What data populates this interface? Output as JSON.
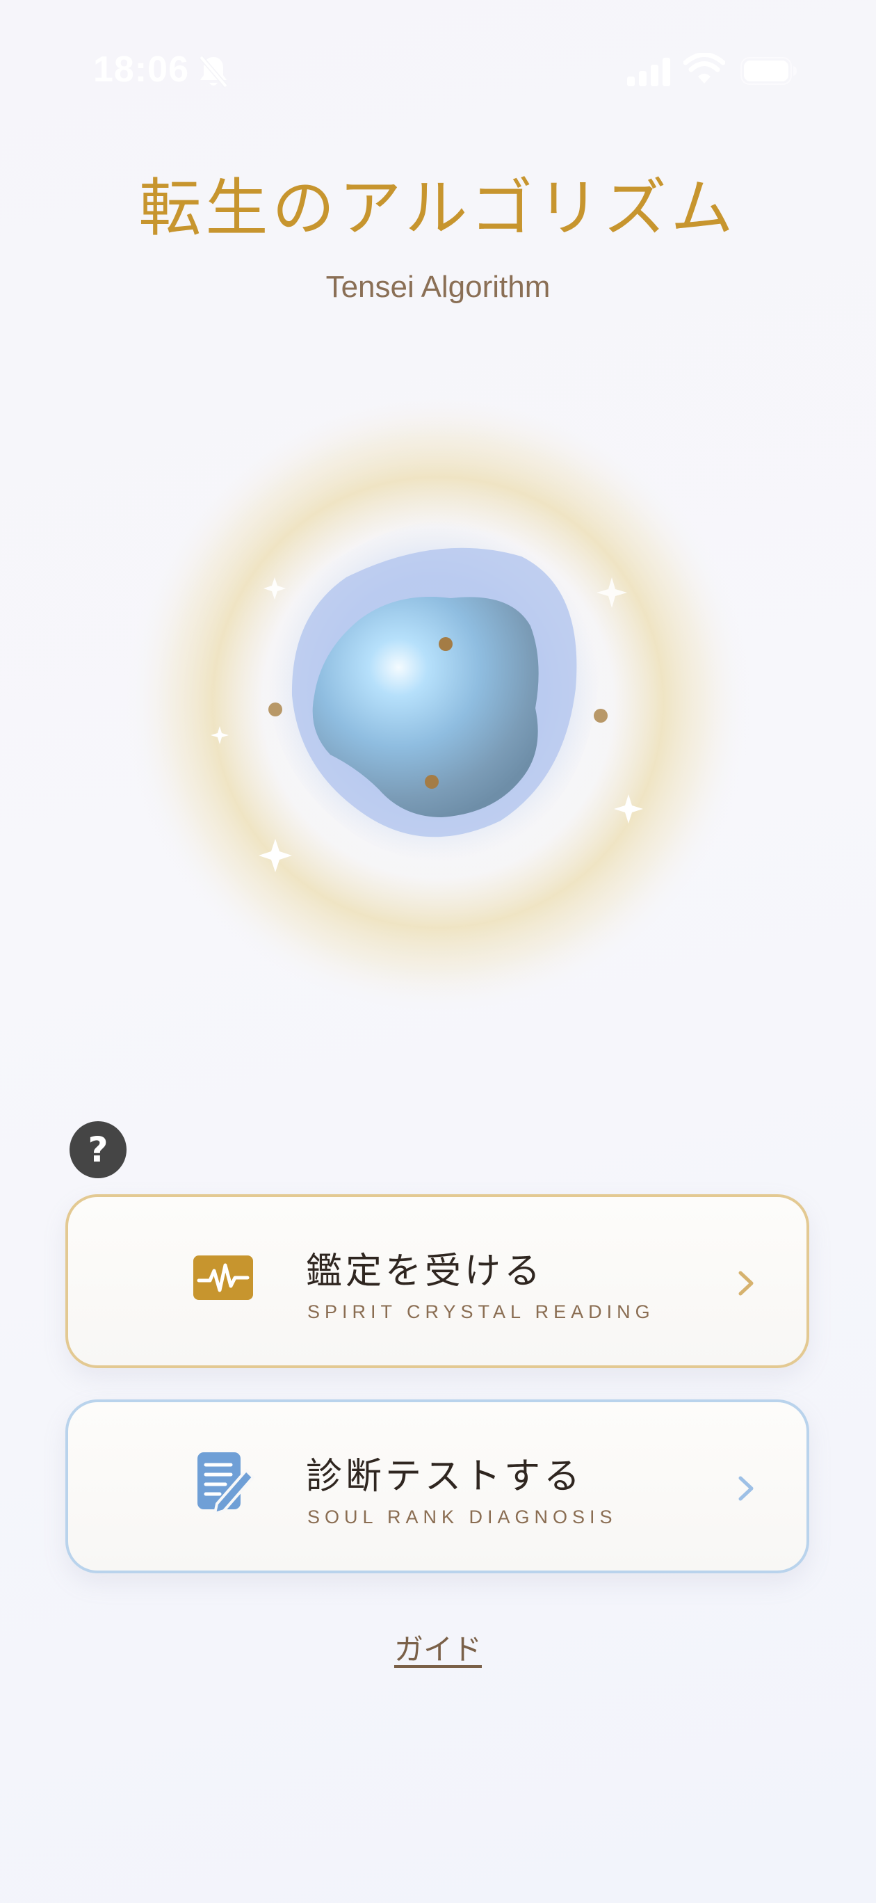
{
  "status_bar": {
    "time": "18:06",
    "icons": [
      "bell-slash-icon",
      "cellular-signal-icon",
      "wifi-icon",
      "battery-icon"
    ]
  },
  "header": {
    "title": "転生のアルゴリズム",
    "subtitle": "Tensei Algorithm"
  },
  "help": {
    "label": "?"
  },
  "actions": [
    {
      "title": "鑑定を受ける",
      "subtitle": "SPIRIT CRYSTAL READING",
      "icon": "pulse-monitor-icon",
      "accent": "#c7952e"
    },
    {
      "title": "診断テストする",
      "subtitle": "SOUL RANK DIAGNOSIS",
      "icon": "document-edit-icon",
      "accent": "#6f9fd6"
    }
  ],
  "guide": {
    "label": "ガイド"
  },
  "colors": {
    "gold": "#c7952e",
    "blue": "#6f9fd6",
    "text_dark": "#2f2620",
    "text_brown": "#8a6d52"
  }
}
